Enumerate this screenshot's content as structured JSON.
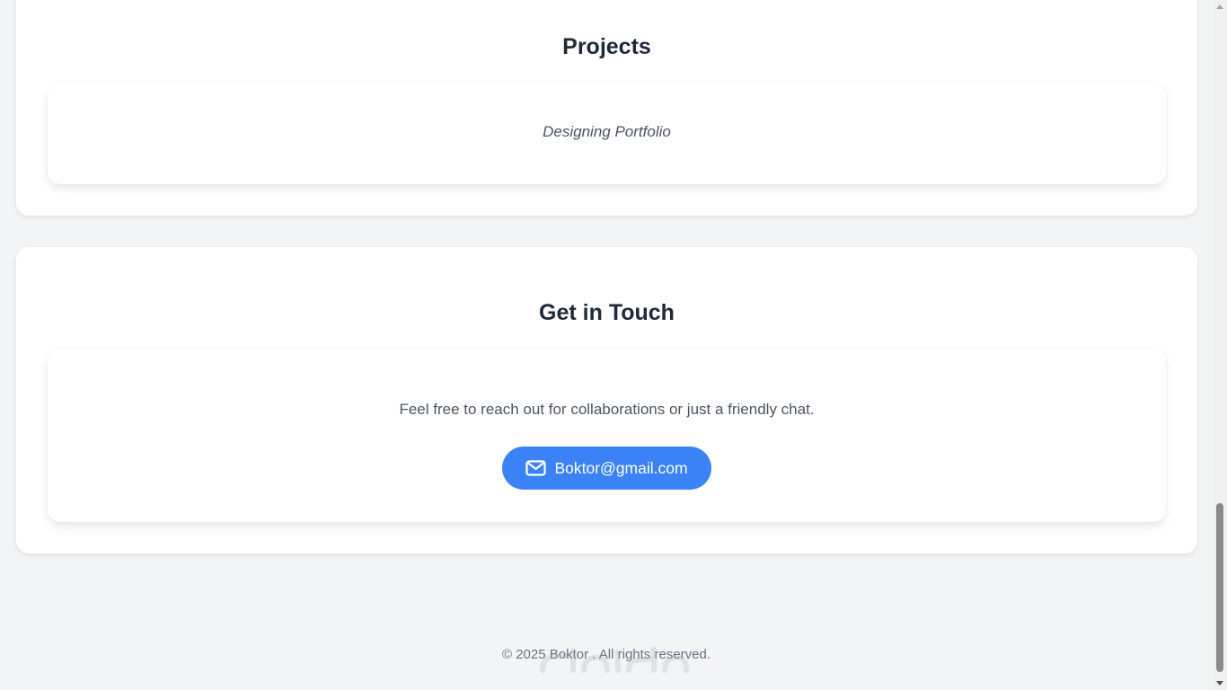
{
  "projects": {
    "title": "Projects",
    "items": [
      {
        "name": "Designing Portfolio"
      }
    ]
  },
  "contact": {
    "title": "Get in Touch",
    "text": "Feel free to reach out for collaborations or just a friendly chat.",
    "email_label": "Boktor@gmail.com",
    "email_icon": "envelope-icon"
  },
  "footer": {
    "copyright": "© 2025 Boktor . All rights reserved."
  },
  "colors": {
    "accent": "#3b82f6",
    "page_background": "#f3f4f6",
    "heading": "#1f2937",
    "muted_text": "#4b5563"
  }
}
